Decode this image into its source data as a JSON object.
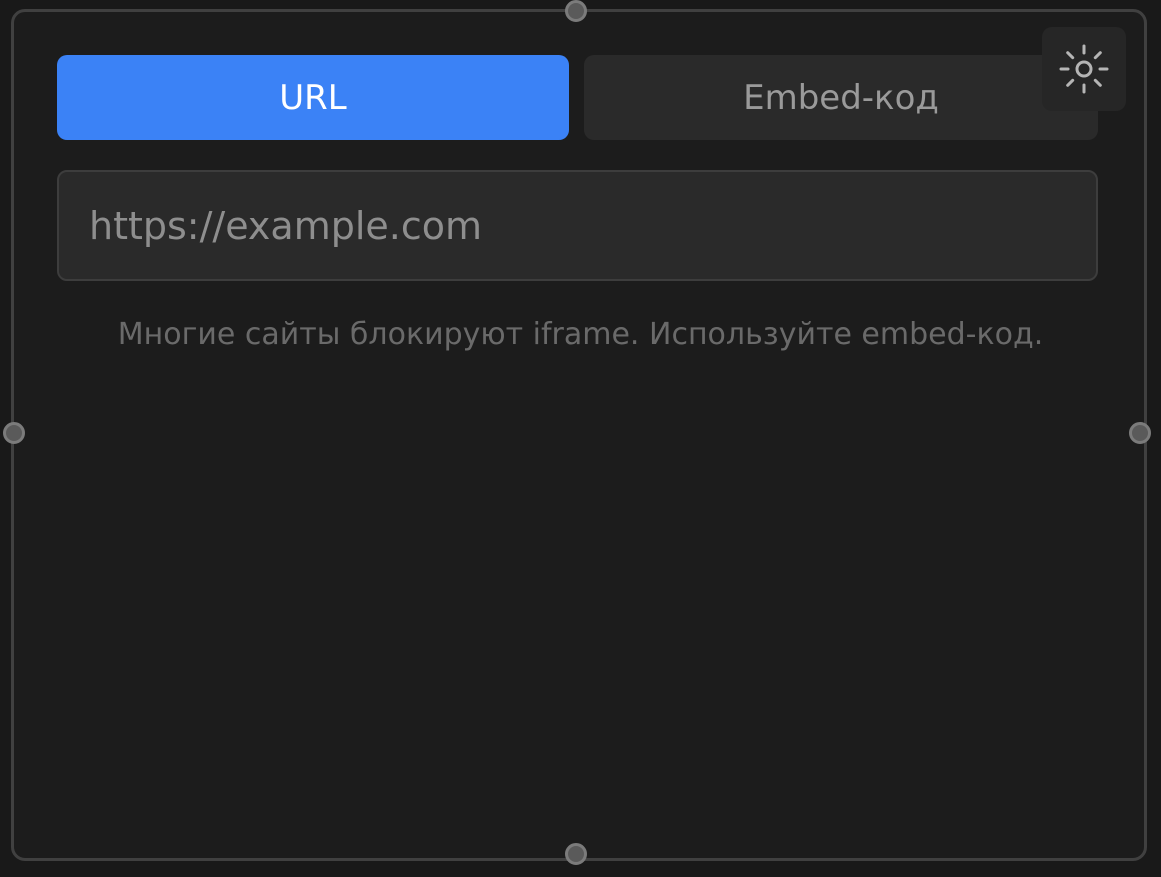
{
  "tabs": {
    "url_label": "URL",
    "embed_label": "Embed-код"
  },
  "url_input": {
    "value": "",
    "placeholder": "https://example.com"
  },
  "hint": {
    "text": "Многие сайты блокируют iframe. Используйте embed-код."
  },
  "icons": {
    "settings": "sun-icon"
  },
  "colors": {
    "active_tab": "#3b82f6",
    "background": "#191919",
    "panel": "#1c1c1c"
  }
}
